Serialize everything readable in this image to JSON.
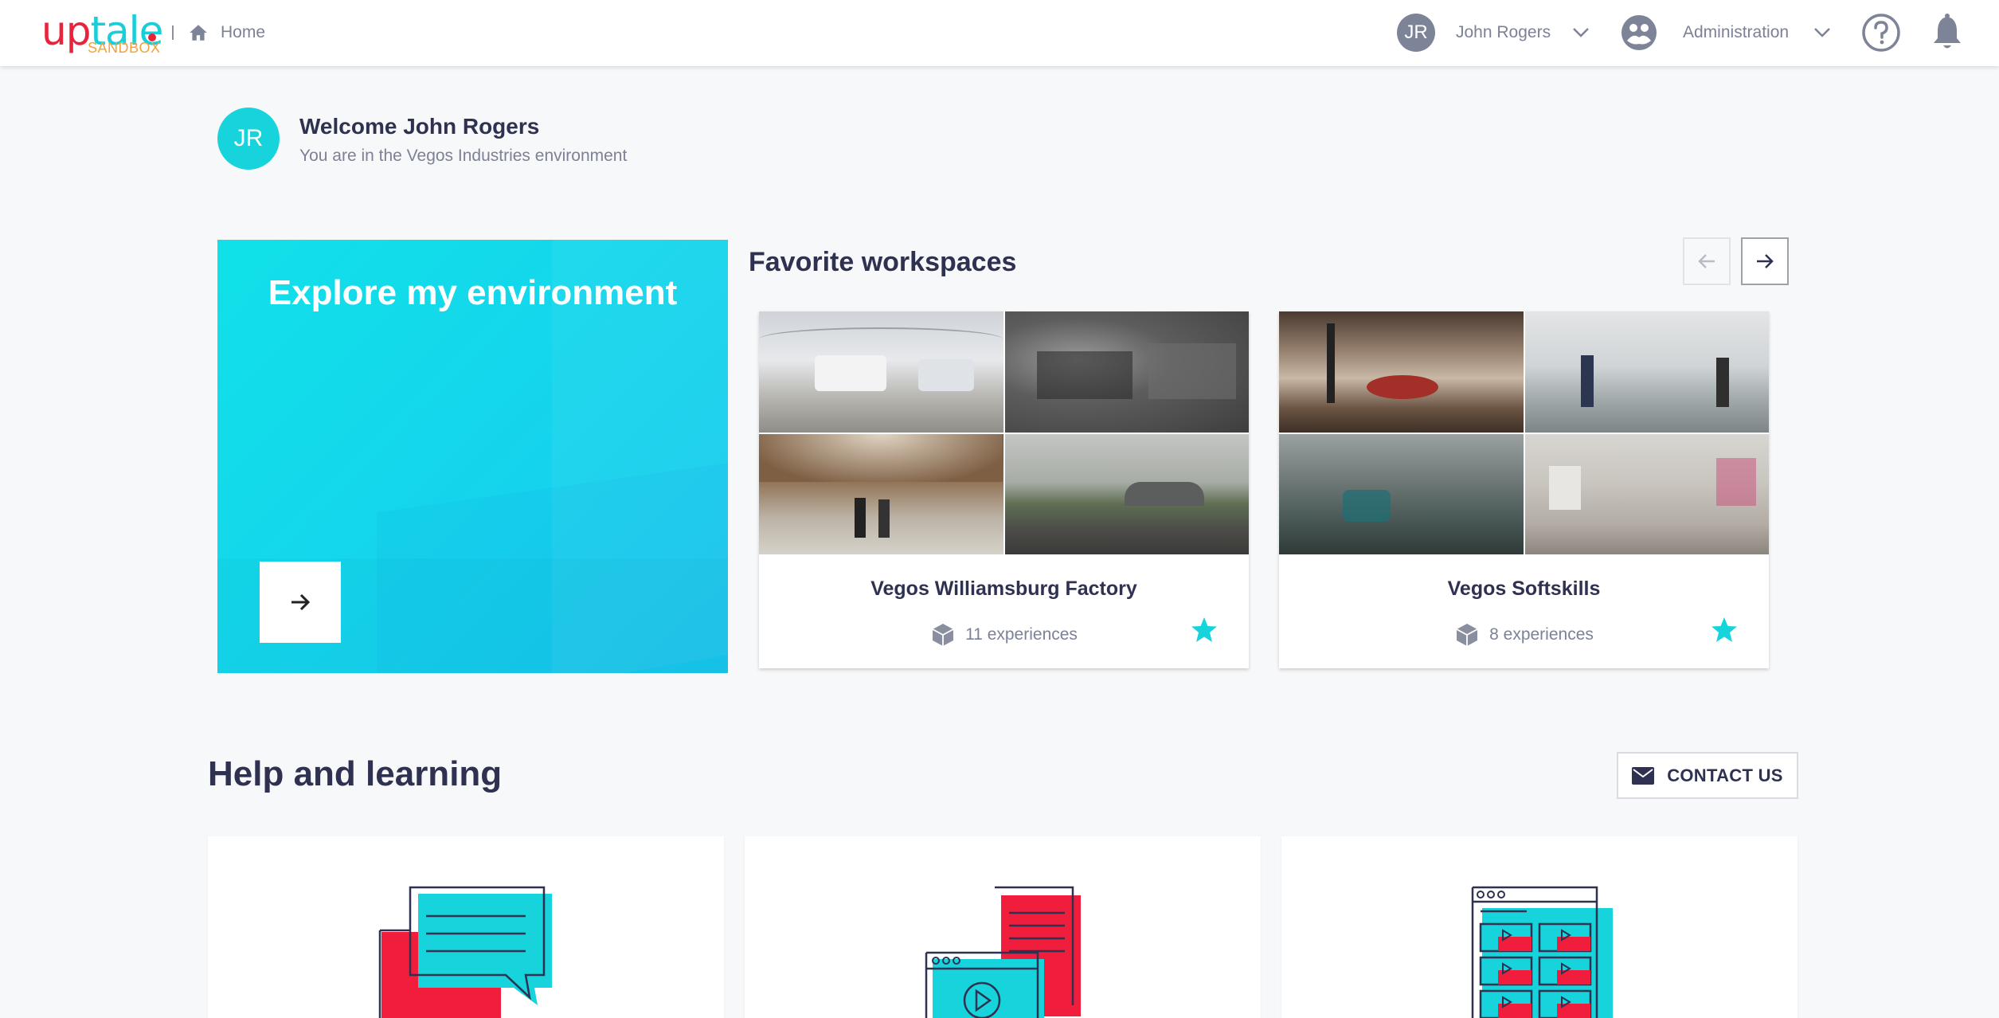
{
  "header": {
    "logo_text_red": "up",
    "logo_text_teal": "tale",
    "logo_sub": "SANDBOX",
    "home_label": "Home",
    "user_initials": "JR",
    "user_name": "John Rogers",
    "admin_label": "Administration"
  },
  "welcome": {
    "initials": "JR",
    "title": "Welcome John Rogers",
    "subtitle": "You are in the Vegos Industries environment"
  },
  "explore": {
    "title": "Explore my environment"
  },
  "favorites": {
    "title": "Favorite workspaces",
    "workspaces": [
      {
        "name": "Vegos Williamsburg Factory",
        "count": "11 experiences"
      },
      {
        "name": "Vegos Softskills",
        "count": "8 experiences"
      }
    ]
  },
  "help": {
    "title": "Help and learning",
    "contact_label": "CONTACT US"
  },
  "colors": {
    "accent_teal": "#17d3dc",
    "brand_red": "#e8233c",
    "text_dark": "#2f3150",
    "text_muted": "#7c8196"
  }
}
